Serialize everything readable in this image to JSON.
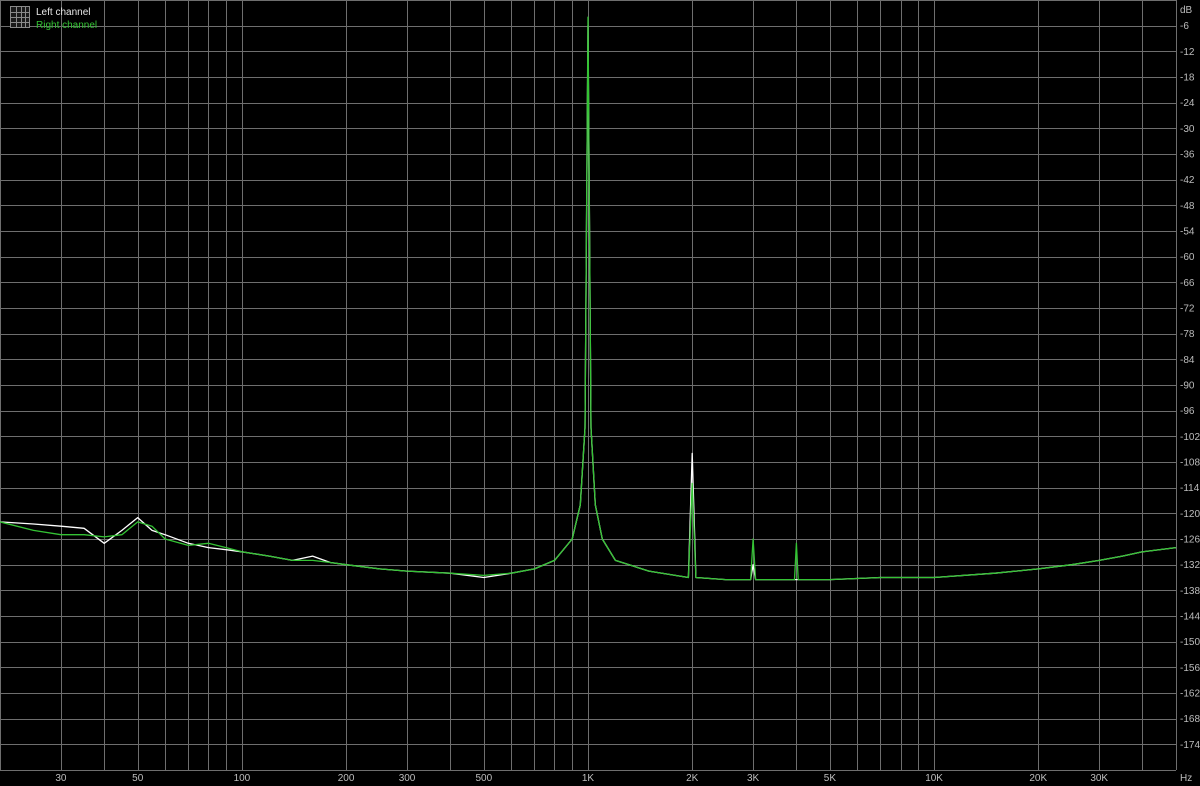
{
  "chart_data": {
    "type": "line",
    "x_scale": "log",
    "xlim": [
      20,
      50000
    ],
    "ylim": [
      -180,
      0
    ],
    "x_unit": "Hz",
    "y_unit": "dB",
    "grid": true,
    "legend_position": "top-left",
    "x_ticks": [
      {
        "value": 30,
        "label": "30"
      },
      {
        "value": 50,
        "label": "50"
      },
      {
        "value": 100,
        "label": "100"
      },
      {
        "value": 200,
        "label": "200"
      },
      {
        "value": 300,
        "label": "300"
      },
      {
        "value": 500,
        "label": "500"
      },
      {
        "value": 1000,
        "label": "1K"
      },
      {
        "value": 2000,
        "label": "2K"
      },
      {
        "value": 3000,
        "label": "3K"
      },
      {
        "value": 5000,
        "label": "5K"
      },
      {
        "value": 10000,
        "label": "10K"
      },
      {
        "value": 20000,
        "label": "20K"
      },
      {
        "value": 30000,
        "label": "30K"
      }
    ],
    "y_ticks": [
      -6,
      -12,
      -18,
      -24,
      -30,
      -36,
      -42,
      -48,
      -54,
      -60,
      -66,
      -72,
      -78,
      -84,
      -90,
      -96,
      -102,
      -108,
      -114,
      -120,
      -126,
      -132,
      -138,
      -144,
      -150,
      -156,
      -162,
      -168,
      -174
    ],
    "series": [
      {
        "name": "Left channel",
        "color": "#ffffff",
        "points": [
          [
            20,
            -122
          ],
          [
            25,
            -122.5
          ],
          [
            30,
            -123
          ],
          [
            35,
            -123.5
          ],
          [
            40,
            -127
          ],
          [
            45,
            -124
          ],
          [
            50,
            -121
          ],
          [
            55,
            -124
          ],
          [
            60,
            -125
          ],
          [
            70,
            -127
          ],
          [
            80,
            -128
          ],
          [
            90,
            -128.5
          ],
          [
            100,
            -129
          ],
          [
            120,
            -130
          ],
          [
            140,
            -131
          ],
          [
            160,
            -130
          ],
          [
            180,
            -131.5
          ],
          [
            200,
            -132
          ],
          [
            250,
            -133
          ],
          [
            300,
            -133.5
          ],
          [
            400,
            -134
          ],
          [
            500,
            -135
          ],
          [
            600,
            -134
          ],
          [
            700,
            -133
          ],
          [
            800,
            -131
          ],
          [
            900,
            -126
          ],
          [
            950,
            -118
          ],
          [
            980,
            -100
          ],
          [
            1000,
            -6
          ],
          [
            1020,
            -100
          ],
          [
            1050,
            -118
          ],
          [
            1100,
            -126
          ],
          [
            1200,
            -131
          ],
          [
            1500,
            -133.5
          ],
          [
            1950,
            -135
          ],
          [
            2000,
            -106
          ],
          [
            2050,
            -135
          ],
          [
            2500,
            -135.5
          ],
          [
            2950,
            -135.5
          ],
          [
            3000,
            -132
          ],
          [
            3050,
            -135.5
          ],
          [
            4000,
            -135.5
          ],
          [
            5000,
            -135.5
          ],
          [
            7000,
            -135
          ],
          [
            10000,
            -135
          ],
          [
            15000,
            -134
          ],
          [
            20000,
            -133
          ],
          [
            25000,
            -132
          ],
          [
            30000,
            -131
          ],
          [
            35000,
            -130
          ],
          [
            40000,
            -129
          ],
          [
            50000,
            -128
          ]
        ]
      },
      {
        "name": "Right channel",
        "color": "#34c334",
        "points": [
          [
            20,
            -122
          ],
          [
            25,
            -124
          ],
          [
            30,
            -125
          ],
          [
            35,
            -125
          ],
          [
            40,
            -125.5
          ],
          [
            45,
            -125
          ],
          [
            50,
            -122
          ],
          [
            55,
            -123
          ],
          [
            60,
            -126
          ],
          [
            70,
            -127.5
          ],
          [
            80,
            -127
          ],
          [
            90,
            -128
          ],
          [
            100,
            -129
          ],
          [
            120,
            -130
          ],
          [
            140,
            -131
          ],
          [
            160,
            -131
          ],
          [
            180,
            -131.5
          ],
          [
            200,
            -132
          ],
          [
            250,
            -133
          ],
          [
            300,
            -133.5
          ],
          [
            400,
            -134
          ],
          [
            500,
            -134.5
          ],
          [
            600,
            -134
          ],
          [
            700,
            -133
          ],
          [
            800,
            -131
          ],
          [
            900,
            -126
          ],
          [
            950,
            -118
          ],
          [
            980,
            -100
          ],
          [
            1000,
            -4
          ],
          [
            1020,
            -100
          ],
          [
            1050,
            -118
          ],
          [
            1100,
            -126
          ],
          [
            1200,
            -131
          ],
          [
            1500,
            -133.5
          ],
          [
            1950,
            -135
          ],
          [
            2000,
            -113
          ],
          [
            2050,
            -135
          ],
          [
            2500,
            -135.5
          ],
          [
            2950,
            -135.5
          ],
          [
            3000,
            -126
          ],
          [
            3050,
            -135.5
          ],
          [
            3950,
            -135.5
          ],
          [
            4000,
            -127
          ],
          [
            4050,
            -135.5
          ],
          [
            5000,
            -135.5
          ],
          [
            7000,
            -135
          ],
          [
            10000,
            -135
          ],
          [
            15000,
            -134
          ],
          [
            20000,
            -133
          ],
          [
            25000,
            -132
          ],
          [
            30000,
            -131
          ],
          [
            35000,
            -130
          ],
          [
            40000,
            -129
          ],
          [
            50000,
            -128
          ]
        ]
      }
    ]
  },
  "legend": {
    "left_label": "Left channel",
    "right_label": "Right channel"
  },
  "colors": {
    "background": "#000000",
    "grid": "#6e6e6e",
    "axis_text": "#bdbdbd"
  }
}
